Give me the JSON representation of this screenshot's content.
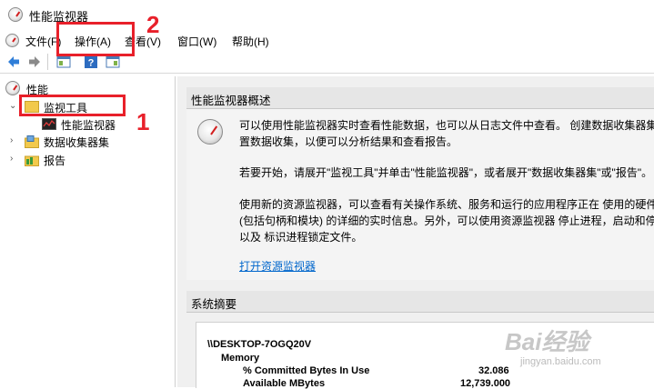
{
  "window": {
    "title": "性能监视器"
  },
  "menu": {
    "file": "文件(F)",
    "action": "操作(A)",
    "view": "查看(V)",
    "window": "窗口(W)",
    "help": "帮助(H)"
  },
  "toolbar": {
    "back": "back-arrow-icon",
    "forward": "forward-arrow-icon",
    "show_hide": "console-tree-icon",
    "help": "help-icon",
    "properties": "properties-icon"
  },
  "tree": {
    "root": "性能",
    "monitoring_tools": "监视工具",
    "perf_monitor": "性能监视器",
    "data_collector_sets": "数据收集器集",
    "reports": "报告"
  },
  "overview": {
    "header": "性能监视器概述",
    "p1_line1": "可以使用性能监视器实时查看性能数据，也可以从日志文件中查看。 创建数据收集器集",
    "p1_line2": "置数据收集，以便可以分析结果和查看报告。",
    "p2": "若要开始，请展开\"监视工具\"并单击\"性能监视器\"，或者展开\"数据收集器集\"或\"报告\"。",
    "p3_line1": "使用新的资源监视器，可以查看有关操作系统、服务和运行的应用程序正在 使用的硬件",
    "p3_line2": "(包括句柄和模块) 的详细的实时信息。另外，可以使用资源监视器 停止进程，启动和停",
    "p3_line3": "以及 标识进程锁定文件。",
    "link": "打开资源监视器"
  },
  "summary": {
    "header": "系统摘要",
    "machine": "\\\\DESKTOP-7OGQ20V",
    "category": "Memory",
    "rows": [
      {
        "name": "% Committed Bytes In Use",
        "value": "32.086"
      },
      {
        "name": "Available MBytes",
        "value": "12,739.000"
      }
    ]
  },
  "annotations": {
    "one": "1",
    "two": "2"
  },
  "watermark": {
    "brand": "Bai经验",
    "url": "jingyan.baidu.com"
  },
  "colors": {
    "annotation_red": "#e8202a",
    "link_blue": "#0066cc"
  }
}
